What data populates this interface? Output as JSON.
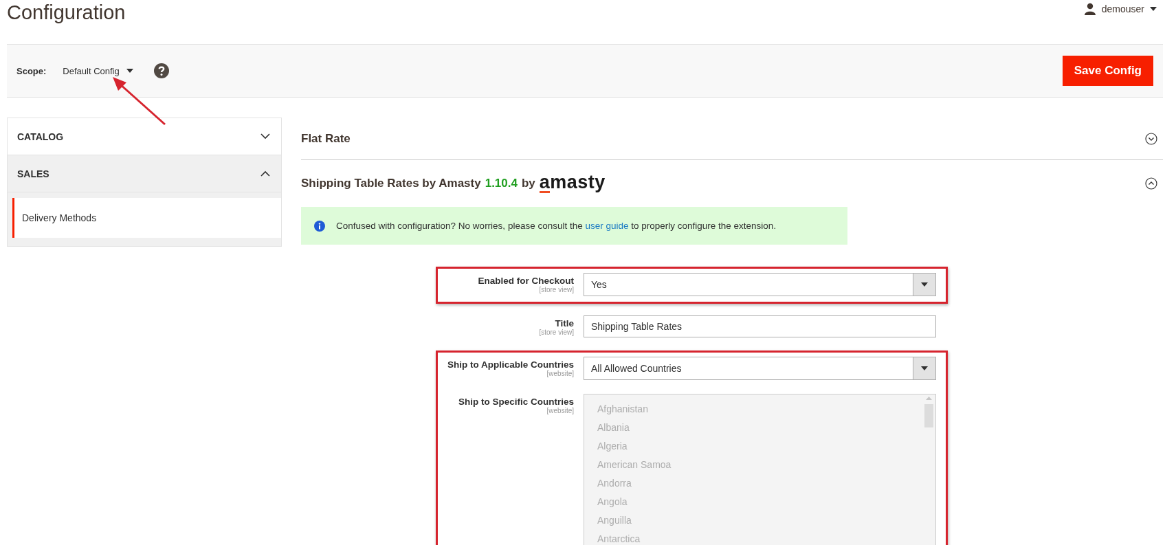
{
  "page_title": "Configuration",
  "user": {
    "name": "demouser"
  },
  "scope": {
    "label": "Scope:",
    "value": "Default Config"
  },
  "save_button": "Save Config",
  "sidebar": {
    "groups": [
      {
        "label": "CATALOG",
        "expanded": false
      },
      {
        "label": "SALES",
        "expanded": true,
        "items": [
          {
            "label": "Delivery Methods",
            "selected": true
          }
        ]
      }
    ]
  },
  "sections": [
    {
      "title": "Flat Rate",
      "expanded": false
    },
    {
      "title": "Shipping Table Rates by Amasty",
      "version": "1.10.4",
      "by": "by",
      "logo": "amasty",
      "expanded": true,
      "notice": {
        "before": "Confused with configuration? No worries, please consult the ",
        "link": "user guide",
        "after": " to properly configure the extension."
      },
      "groups": [
        {
          "highlighted": true,
          "fields": [
            {
              "kind": "select",
              "label": "Enabled for Checkout",
              "scope": "[store view]",
              "value": "Yes"
            }
          ]
        },
        {
          "highlighted": false,
          "fields": [
            {
              "kind": "text",
              "label": "Title",
              "scope": "[store view]",
              "value": "Shipping Table Rates"
            }
          ]
        },
        {
          "highlighted": true,
          "fields": [
            {
              "kind": "select",
              "label": "Ship to Applicable Countries",
              "scope": "[website]",
              "value": "All Allowed Countries"
            },
            {
              "kind": "multiselect",
              "label": "Ship to Specific Countries",
              "scope": "[website]",
              "disabled": true,
              "options": [
                "Afghanistan",
                "Albania",
                "Algeria",
                "American Samoa",
                "Andorra",
                "Angola",
                "Anguilla",
                "Antarctica"
              ]
            }
          ]
        }
      ]
    }
  ]
}
